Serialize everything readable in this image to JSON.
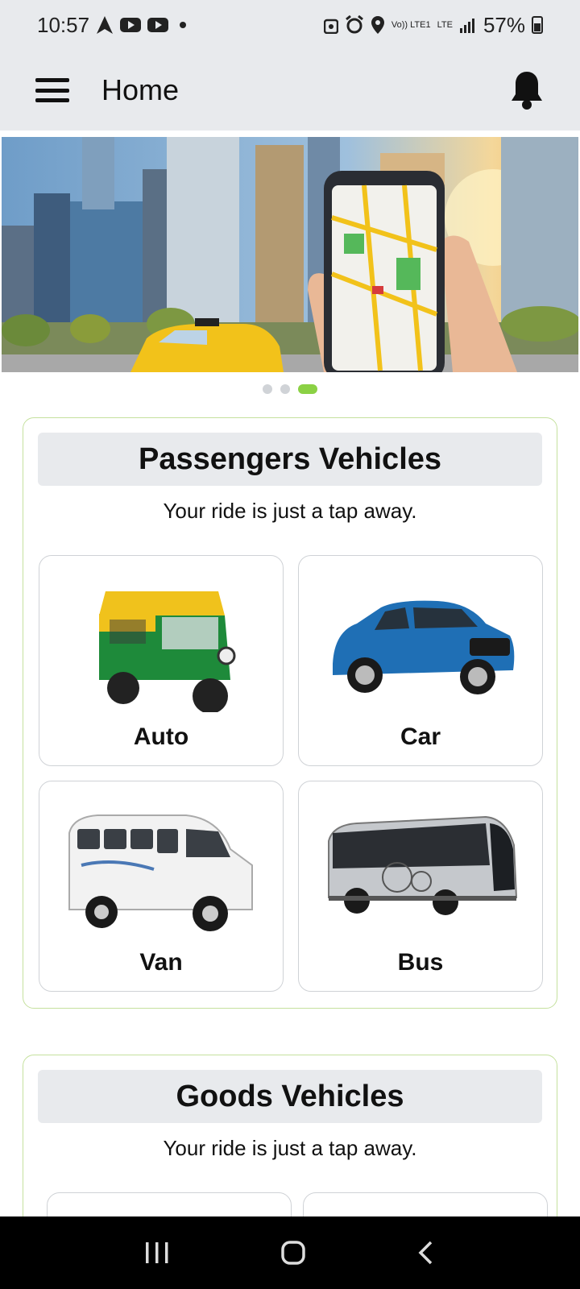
{
  "status_bar": {
    "time": "10:57",
    "battery": "57%",
    "volte": "Vo)) LTE1",
    "lte": "LTE"
  },
  "app_bar": {
    "title": "Home"
  },
  "banner": {
    "slides_total": 3,
    "active_slide": 3
  },
  "passenger_section": {
    "title": "Passengers Vehicles",
    "subtitle": "Your ride is just a tap away.",
    "vehicles": [
      {
        "label": "Auto",
        "icon": "auto-rickshaw-image"
      },
      {
        "label": "Car",
        "icon": "car-image"
      },
      {
        "label": "Van",
        "icon": "van-image"
      },
      {
        "label": "Bus",
        "icon": "bus-image"
      }
    ]
  },
  "goods_section": {
    "title": "Goods Vehicles",
    "subtitle": "Your ride is just a tap away."
  },
  "colors": {
    "accent": "#8bd144",
    "section_border": "#c5e19e",
    "header_bg": "#e8eaed"
  }
}
